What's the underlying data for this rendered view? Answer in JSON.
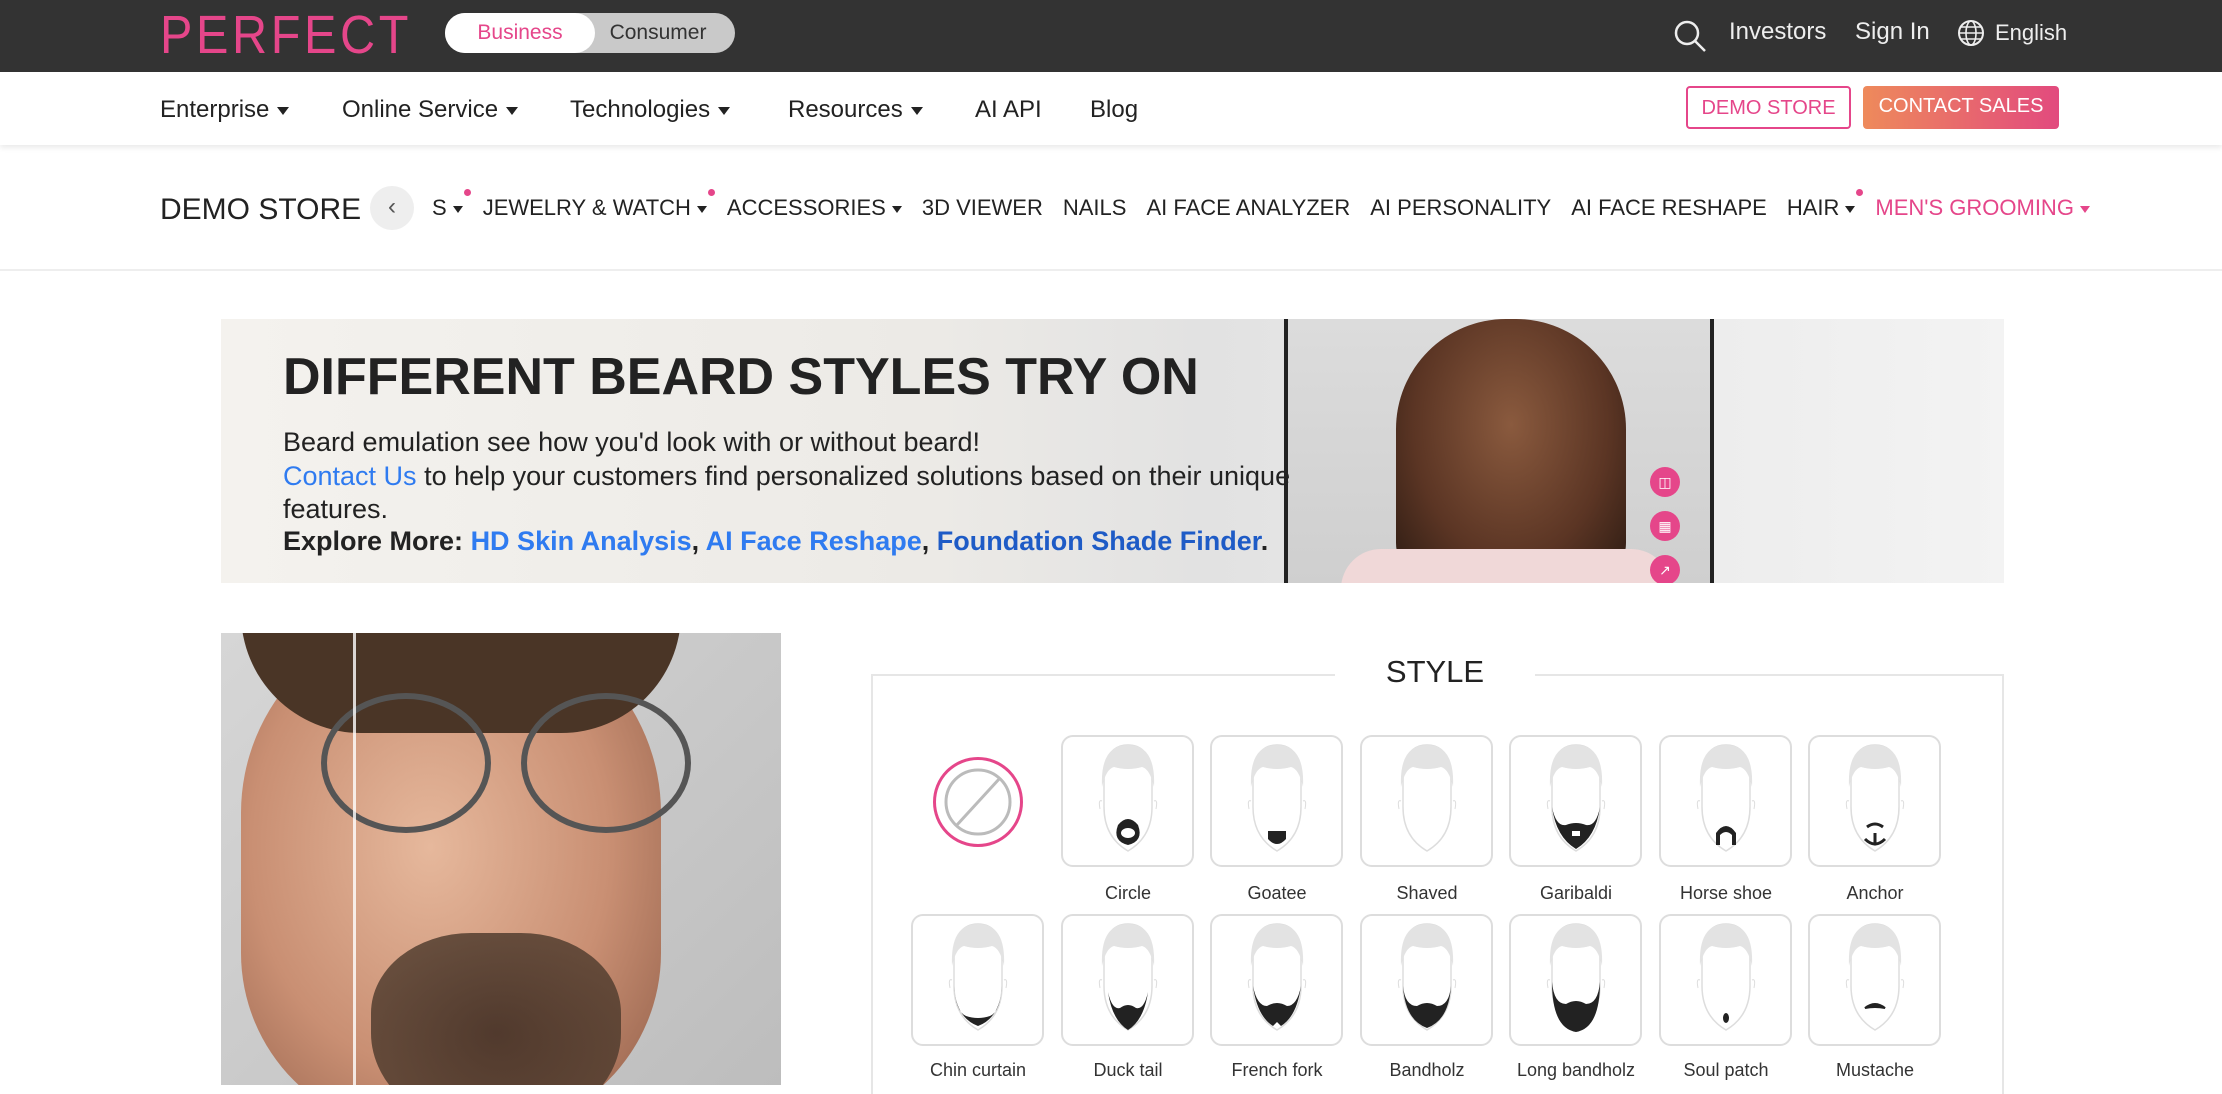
{
  "topbar": {
    "logo": "PERFECT",
    "toggle": {
      "business": "Business",
      "consumer": "Consumer",
      "selected": "Business"
    },
    "links": {
      "investors": "Investors",
      "sign_in": "Sign In",
      "language": "English"
    },
    "icons": {
      "search": "search-icon",
      "language": "globe-icon"
    }
  },
  "nav": {
    "items": [
      {
        "label": "Enterprise",
        "dropdown": true
      },
      {
        "label": "Online Service",
        "dropdown": true
      },
      {
        "label": "Technologies",
        "dropdown": true
      },
      {
        "label": "Resources",
        "dropdown": true
      },
      {
        "label": "AI API",
        "dropdown": false
      },
      {
        "label": "Blog",
        "dropdown": false
      }
    ],
    "demo_store": "DEMO STORE",
    "contact_sales": "CONTACT SALES"
  },
  "store": {
    "title": "DEMO STORE",
    "items": [
      {
        "label": "S",
        "dropdown": true,
        "dot": true
      },
      {
        "label": "JEWELRY & WATCH",
        "dropdown": true,
        "dot": true
      },
      {
        "label": "ACCESSORIES",
        "dropdown": true
      },
      {
        "label": "3D VIEWER"
      },
      {
        "label": "NAILS"
      },
      {
        "label": "AI FACE ANALYZER"
      },
      {
        "label": "AI PERSONALITY"
      },
      {
        "label": "AI FACE RESHAPE"
      },
      {
        "label": "HAIR",
        "dropdown": true,
        "dot": true
      },
      {
        "label": "MEN'S GROOMING",
        "dropdown": true,
        "active": true
      }
    ]
  },
  "banner": {
    "title": "DIFFERENT BEARD STYLES TRY ON",
    "line1": "Beard emulation see how you'd look with or without beard!",
    "contact": "Contact Us",
    "line2": " to help your customers find personalized solutions based on their unique",
    "line3": "features.",
    "explore": "Explore More:",
    "links": [
      "HD Skin Analysis",
      "AI Face Reshape",
      "Foundation Shade Finder"
    ],
    "sep": ", ",
    "end": "."
  },
  "style": {
    "title": "STYLE",
    "options": [
      {
        "label": "Circle",
        "icon": "circle"
      },
      {
        "label": "Goatee",
        "icon": "goatee"
      },
      {
        "label": "Shaved",
        "icon": "shaved"
      },
      {
        "label": "Garibaldi",
        "icon": "garibaldi"
      },
      {
        "label": "Horse shoe",
        "icon": "horseshoe"
      },
      {
        "label": "Anchor",
        "icon": "anchor"
      },
      {
        "label": "Chin curtain",
        "icon": "chincurtain"
      },
      {
        "label": "Duck tail",
        "icon": "ducktail"
      },
      {
        "label": "French fork",
        "icon": "frenchfork"
      },
      {
        "label": "Bandholz",
        "icon": "bandholz"
      },
      {
        "label": "Long bandholz",
        "icon": "longbandholz"
      },
      {
        "label": "Soul patch",
        "icon": "soulpatch"
      },
      {
        "label": "Mustache",
        "icon": "mustache"
      }
    ]
  },
  "colors": {
    "accent": "#e5468a",
    "topbar": "#333333",
    "link": "#2f7bf0"
  }
}
